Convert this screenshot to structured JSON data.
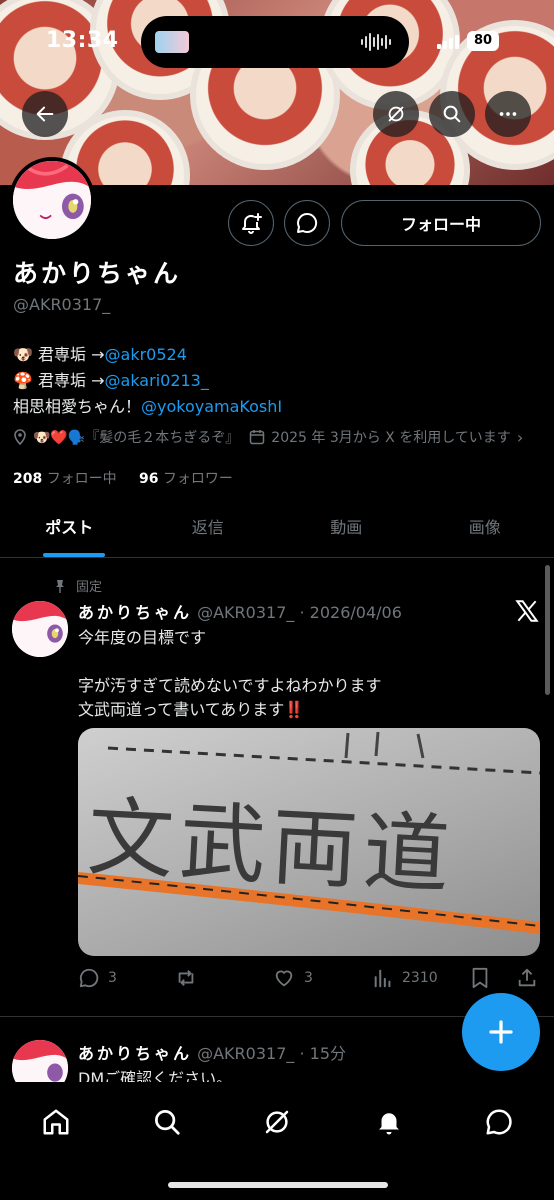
{
  "status_bar": {
    "time": "13:34",
    "battery": "80"
  },
  "header": {
    "back_icon": "arrow-left-icon",
    "grok_icon": "grok-icon",
    "search_icon": "search-icon",
    "more_icon": "more-horizontal-icon"
  },
  "profile": {
    "name": "あかりちゃん",
    "handle": "@AKR0317_",
    "follow_button": "フォロー中",
    "bio": [
      {
        "prefix": "🐶 君専垢 →",
        "link": "@akr0524"
      },
      {
        "prefix": "🍄 君専垢 →",
        "link": "@akari0213_"
      },
      {
        "prefix": "相思相愛ちゃん！",
        "link": "@yokoyamaKoshI"
      }
    ],
    "location": "🐶❤️🗣️『髪の毛２本ちぎるぞ』",
    "joined": "2025 年 3月から X を利用しています",
    "following_count": "208",
    "following_label": "フォロー中",
    "followers_count": "96",
    "followers_label": "フォロワー"
  },
  "tabs": [
    {
      "label": "ポスト",
      "active": true
    },
    {
      "label": "返信",
      "active": false
    },
    {
      "label": "動画",
      "active": false
    },
    {
      "label": "画像",
      "active": false
    }
  ],
  "pinned_tweet": {
    "pinned_label": "固定",
    "author": "あかりちゃん",
    "handle": "@AKR0317_",
    "date": "2026/04/06",
    "lines": [
      "今年度の目標です",
      "字が汚すぎて読めないですよねわかります",
      "文武両道って書いてあります‼️"
    ],
    "image_text": "文武両道",
    "replies": "3",
    "likes": "3",
    "views": "2310"
  },
  "second_tweet": {
    "author": "あかりちゃん",
    "handle": "@AKR0317_",
    "time": "15分",
    "text": "DMご確認ください。"
  },
  "colors": {
    "accent": "#1d9bf0",
    "muted": "#71767b",
    "background": "#000000"
  }
}
